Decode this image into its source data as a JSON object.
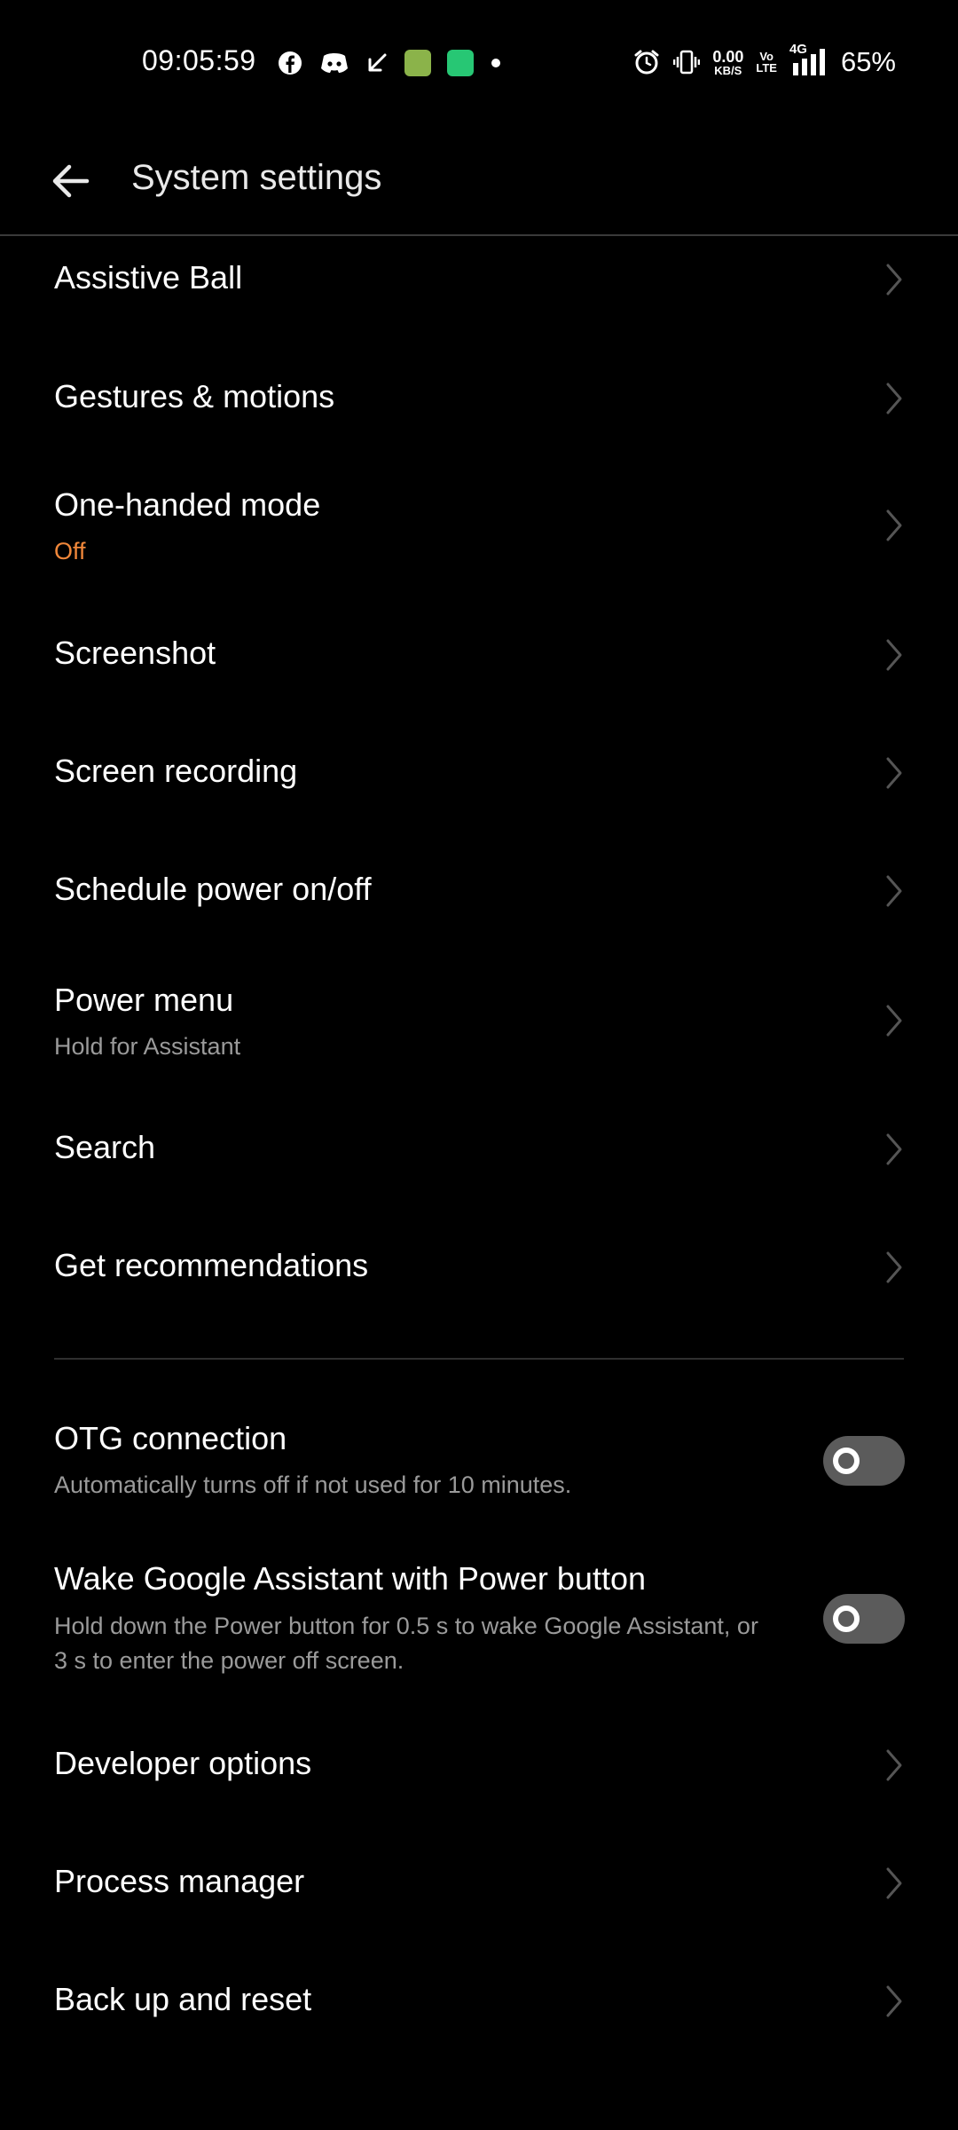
{
  "status_bar": {
    "time": "09:05:59",
    "data_speed_value": "0.00",
    "data_speed_unit": "KB/S",
    "volte_top": "Vo",
    "volte_bottom": "LTE",
    "network": "4G",
    "battery": "65%",
    "left_icons": [
      "facebook-icon",
      "discord-icon",
      "download-arrow-icon",
      "app-icon",
      "app-icon",
      "dot-icon"
    ],
    "right_icons": [
      "alarm-icon",
      "vibrate-icon",
      "signal-icon"
    ]
  },
  "header": {
    "title": "System settings",
    "back_icon": "arrow-left-icon"
  },
  "items": [
    {
      "title": "Assistive Ball"
    },
    {
      "title": "Gestures & motions"
    },
    {
      "title": "One-handed mode",
      "subtitle": "Off"
    },
    {
      "title": "Screenshot"
    },
    {
      "title": "Screen recording"
    },
    {
      "title": "Schedule power on/off"
    },
    {
      "title": "Power menu",
      "subtitle": "Hold for Assistant"
    },
    {
      "title": "Search"
    },
    {
      "title": "Get recommendations"
    }
  ],
  "toggles": [
    {
      "title": "OTG connection",
      "subtitle": "Automatically turns off if not used for 10 minutes.",
      "enabled": false
    },
    {
      "title": "Wake Google Assistant with Power button",
      "subtitle_line1": "Hold down the Power button for 0.5 s to wake Google Assistant, or",
      "subtitle_line2": "3 s to enter the power off screen.",
      "enabled": false
    }
  ],
  "bottom_items": [
    {
      "title": "Developer options"
    },
    {
      "title": "Process manager"
    },
    {
      "title": "Back up and reset"
    }
  ],
  "colors": {
    "background": "#000000",
    "accent_orange": "#f0873a",
    "toggle_off": "#5b5b5b"
  }
}
